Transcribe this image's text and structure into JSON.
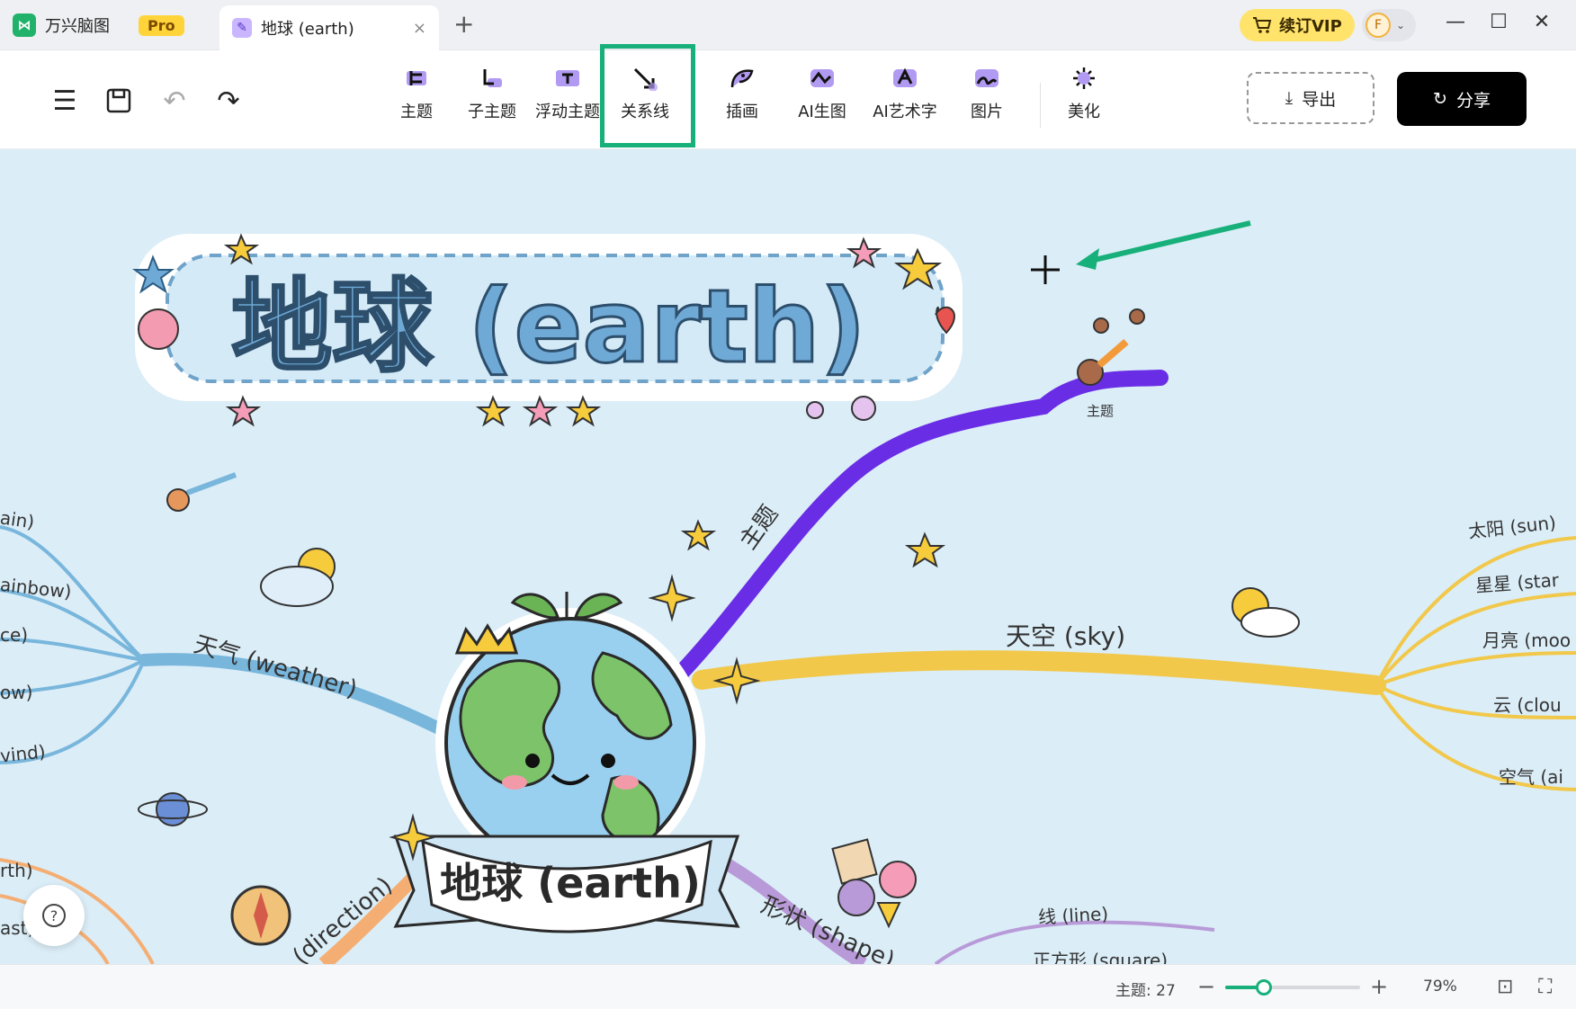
{
  "titlebar": {
    "app_name": "万兴脑图",
    "pro_badge": "Pro",
    "doc_tab_title": "地球 (earth)",
    "close_glyph": "×",
    "new_tab_glyph": "+",
    "vip_label": "续订VIP",
    "avatar_letter": "F",
    "window_controls": {
      "minimize": "—",
      "maximize": "☐",
      "close": "✕"
    }
  },
  "toolbar": {
    "tools": [
      {
        "label": "主题",
        "icon": "topic-icon"
      },
      {
        "label": "子主题",
        "icon": "subtopic-icon"
      },
      {
        "label": "浮动主题",
        "icon": "floating-topic-icon"
      },
      {
        "label": "关系线",
        "icon": "relationship-line-icon"
      },
      {
        "label": "插画",
        "icon": "illustration-icon"
      },
      {
        "label": "AI生图",
        "icon": "ai-image-icon"
      },
      {
        "label": "AI艺术字",
        "icon": "ai-art-text-icon"
      },
      {
        "label": "图片",
        "icon": "image-icon"
      },
      {
        "label": "美化",
        "icon": "beautify-icon"
      }
    ],
    "export_label": "导出",
    "share_label": "分享"
  },
  "canvas": {
    "banner_title": "地球 (earth)",
    "central_topic": "地球 (earth)",
    "floating_topic": "主题",
    "branch_topic_label": "主题",
    "branches": {
      "weather": "天气 (weather)",
      "sky": "天空 (sky)",
      "shape": "形状 (shape)",
      "direction": "(direction)"
    },
    "weather_children": [
      "ain)",
      "ainbow)",
      "ce)",
      "ow)",
      "vind)"
    ],
    "sky_children": [
      "太阳 (sun)",
      "星星 (star",
      "月亮 (moo",
      "云 (clou",
      "空气 (ai"
    ],
    "shape_children": [
      "线 (line)",
      "正方形 (square)"
    ],
    "direction_children": [
      "rth)",
      "ast)"
    ]
  },
  "status": {
    "topic_count": "主题: 27",
    "zoom_percent": 79,
    "zoom_label": "79%",
    "help_glyph": "?"
  },
  "colors": {
    "accent": "#18b07a",
    "canvas_bg": "#dbedf7",
    "branch_purple": "#6a2de6",
    "branch_yellow": "#f1c84a",
    "branch_blue": "#78b6dc",
    "branch_orange": "#f4ae73",
    "branch_lilac": "#b89ad8"
  }
}
